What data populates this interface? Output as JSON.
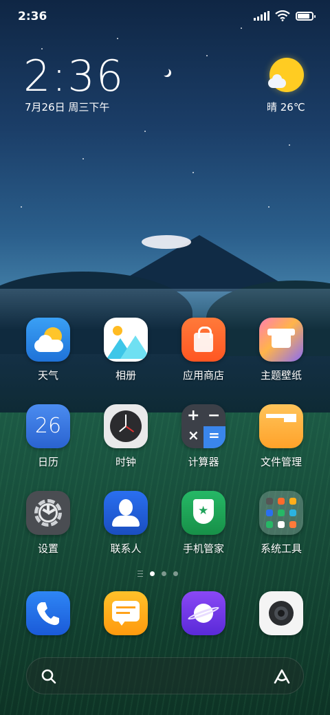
{
  "status_bar": {
    "time": "2:36",
    "battery_percent": 85
  },
  "clock_widget": {
    "time": "2:36",
    "date": "7月26日 周三下午"
  },
  "weather_widget": {
    "text": "晴 26℃",
    "icon": "sunny-cloud-icon"
  },
  "apps": [
    {
      "label": "天气",
      "icon": "weather-icon"
    },
    {
      "label": "相册",
      "icon": "gallery-icon"
    },
    {
      "label": "应用商店",
      "icon": "app-store-icon"
    },
    {
      "label": "主题壁纸",
      "icon": "themes-icon"
    },
    {
      "label": "日历",
      "icon": "calendar-icon",
      "day": "26"
    },
    {
      "label": "时钟",
      "icon": "clock-icon"
    },
    {
      "label": "计算器",
      "icon": "calculator-icon"
    },
    {
      "label": "文件管理",
      "icon": "file-manager-icon"
    },
    {
      "label": "设置",
      "icon": "settings-icon"
    },
    {
      "label": "联系人",
      "icon": "contacts-icon"
    },
    {
      "label": "手机管家",
      "icon": "security-icon"
    },
    {
      "label": "系统工具",
      "icon": "folder-icon"
    }
  ],
  "dock": [
    {
      "icon": "phone-icon"
    },
    {
      "icon": "messages-icon"
    },
    {
      "icon": "browser-icon"
    },
    {
      "icon": "camera-icon"
    }
  ],
  "page_indicator": {
    "pages": 3,
    "current": 1
  },
  "colors": {
    "weather": "#2f8ee8",
    "appstore": "#ff6a2c",
    "calendar": "#3a78e0",
    "calculator": "#3c4048",
    "files": "#ffb43a",
    "contacts": "#1f5fd8",
    "security": "#1fa25a",
    "phone": "#1f6fe0",
    "messages": "#ffae1a",
    "browser": "#7a3cf0",
    "camera": "#f0f0f0"
  }
}
